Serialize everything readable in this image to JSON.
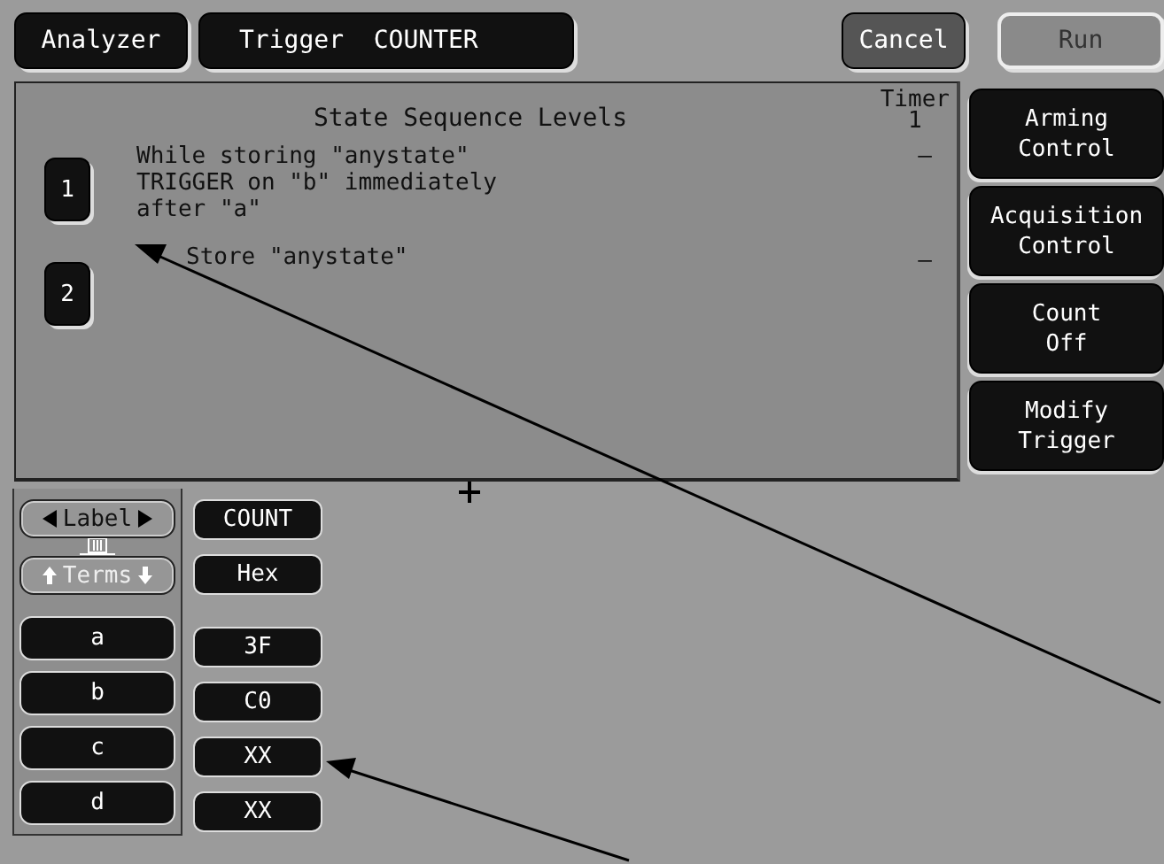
{
  "top_bar": {
    "buttons": [
      {
        "label": "Analyzer",
        "kind": "menu",
        "disabled": false
      },
      {
        "label": "Trigger  COUNTER",
        "kind": "menu",
        "disabled": false
      },
      {
        "label": "Cancel",
        "kind": "action",
        "disabled": false
      },
      {
        "label": "Run",
        "kind": "action",
        "disabled": true
      }
    ]
  },
  "sequence_panel": {
    "title": "State Sequence Levels",
    "timer_heading": "Timer\n1",
    "levels": [
      {
        "number": "1",
        "text": "While storing \"anystate\"\nTRIGGER on \"b\" immediately\nafter \"a\"",
        "timer": "–"
      },
      {
        "number": "2",
        "text": "Store \"anystate\"",
        "timer": "–"
      }
    ]
  },
  "side_menu": [
    "Arming\nControl",
    "Acquisition\nControl",
    "Count\nOff",
    "Modify\nTrigger"
  ],
  "terms_panel": {
    "label_selector": "Label",
    "terms_selector": "Terms",
    "terms": [
      "a",
      "b",
      "c",
      "d"
    ]
  },
  "values_column": {
    "label": "COUNT",
    "base": "Hex",
    "values": [
      "3F",
      "C0",
      "XX",
      "XX"
    ]
  }
}
